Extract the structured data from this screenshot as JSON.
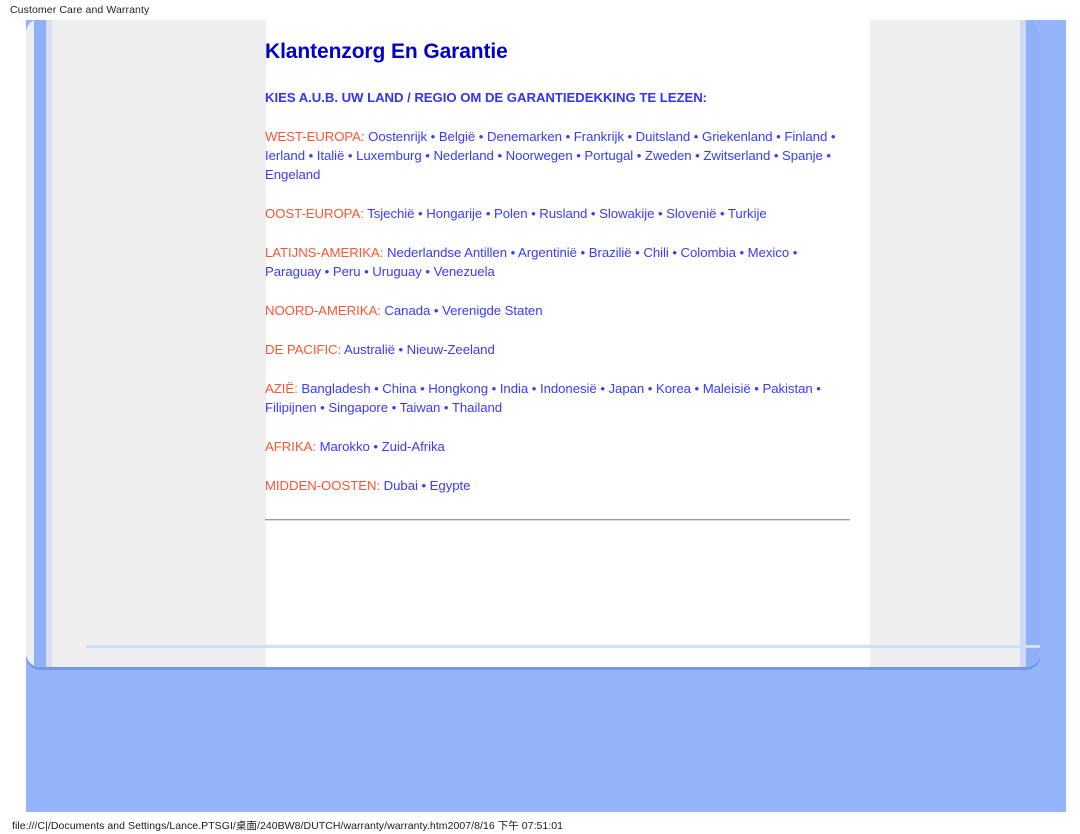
{
  "browser": {
    "header_caption": "Customer Care and Warranty",
    "status_path": "file:///C|/Documents and Settings/Lance.PTSGI/桌面/240BW8/DUTCH/warranty/warranty.htm",
    "status_timestamp": "2007/8/16 下午 07:51:01"
  },
  "colors": {
    "backdrop_blue": "#94b4fa",
    "panel_white": "#ffffff",
    "column_gray": "#eeeeee",
    "accent_blue": "#8fb0f7",
    "title_blue": "#0000cd",
    "link_blue": "#3a3aff",
    "region_orange": "#ff5533"
  },
  "document": {
    "title": "Klantenzorg En Garantie",
    "intro": "KIES A.U.B. UW LAND / REGIO OM DE GARANTIEDEKKING TE LEZEN:",
    "regions": [
      {
        "label": "WEST-EUROPA:",
        "countries": "Oostenrijk • België • Denemarken • Frankrijk • Duitsland • Griekenland • Finland • Ierland • Italië • Luxemburg • Nederland • Noorwegen • Portugal • Zweden • Zwitserland • Spanje • Engeland"
      },
      {
        "label": "OOST-EUROPA:",
        "countries": "Tsjechië • Hongarije • Polen • Rusland • Slowakije • Slovenië • Turkije"
      },
      {
        "label": "LATIJNS-AMERIKA:",
        "countries": "Nederlandse Antillen • Argentinië • Brazilië • Chili • Colombia • Mexico • Paraguay • Peru • Uruguay • Venezuela"
      },
      {
        "label": "NOORD-AMERIKA:",
        "countries": "Canada • Verenigde Staten"
      },
      {
        "label": "DE PACIFIC:",
        "countries": "Australië • Nieuw-Zeeland"
      },
      {
        "label": "AZIË:",
        "countries": "Bangladesh • China • Hongkong • India • Indonesië • Japan • Korea • Maleisië • Pakistan • Filipijnen • Singapore • Taiwan • Thailand"
      },
      {
        "label": "AFRIKA:",
        "countries": "Marokko • Zuid-Afrika"
      },
      {
        "label": "MIDDEN-OOSTEN:",
        "countries": "Dubai • Egypte"
      }
    ]
  }
}
